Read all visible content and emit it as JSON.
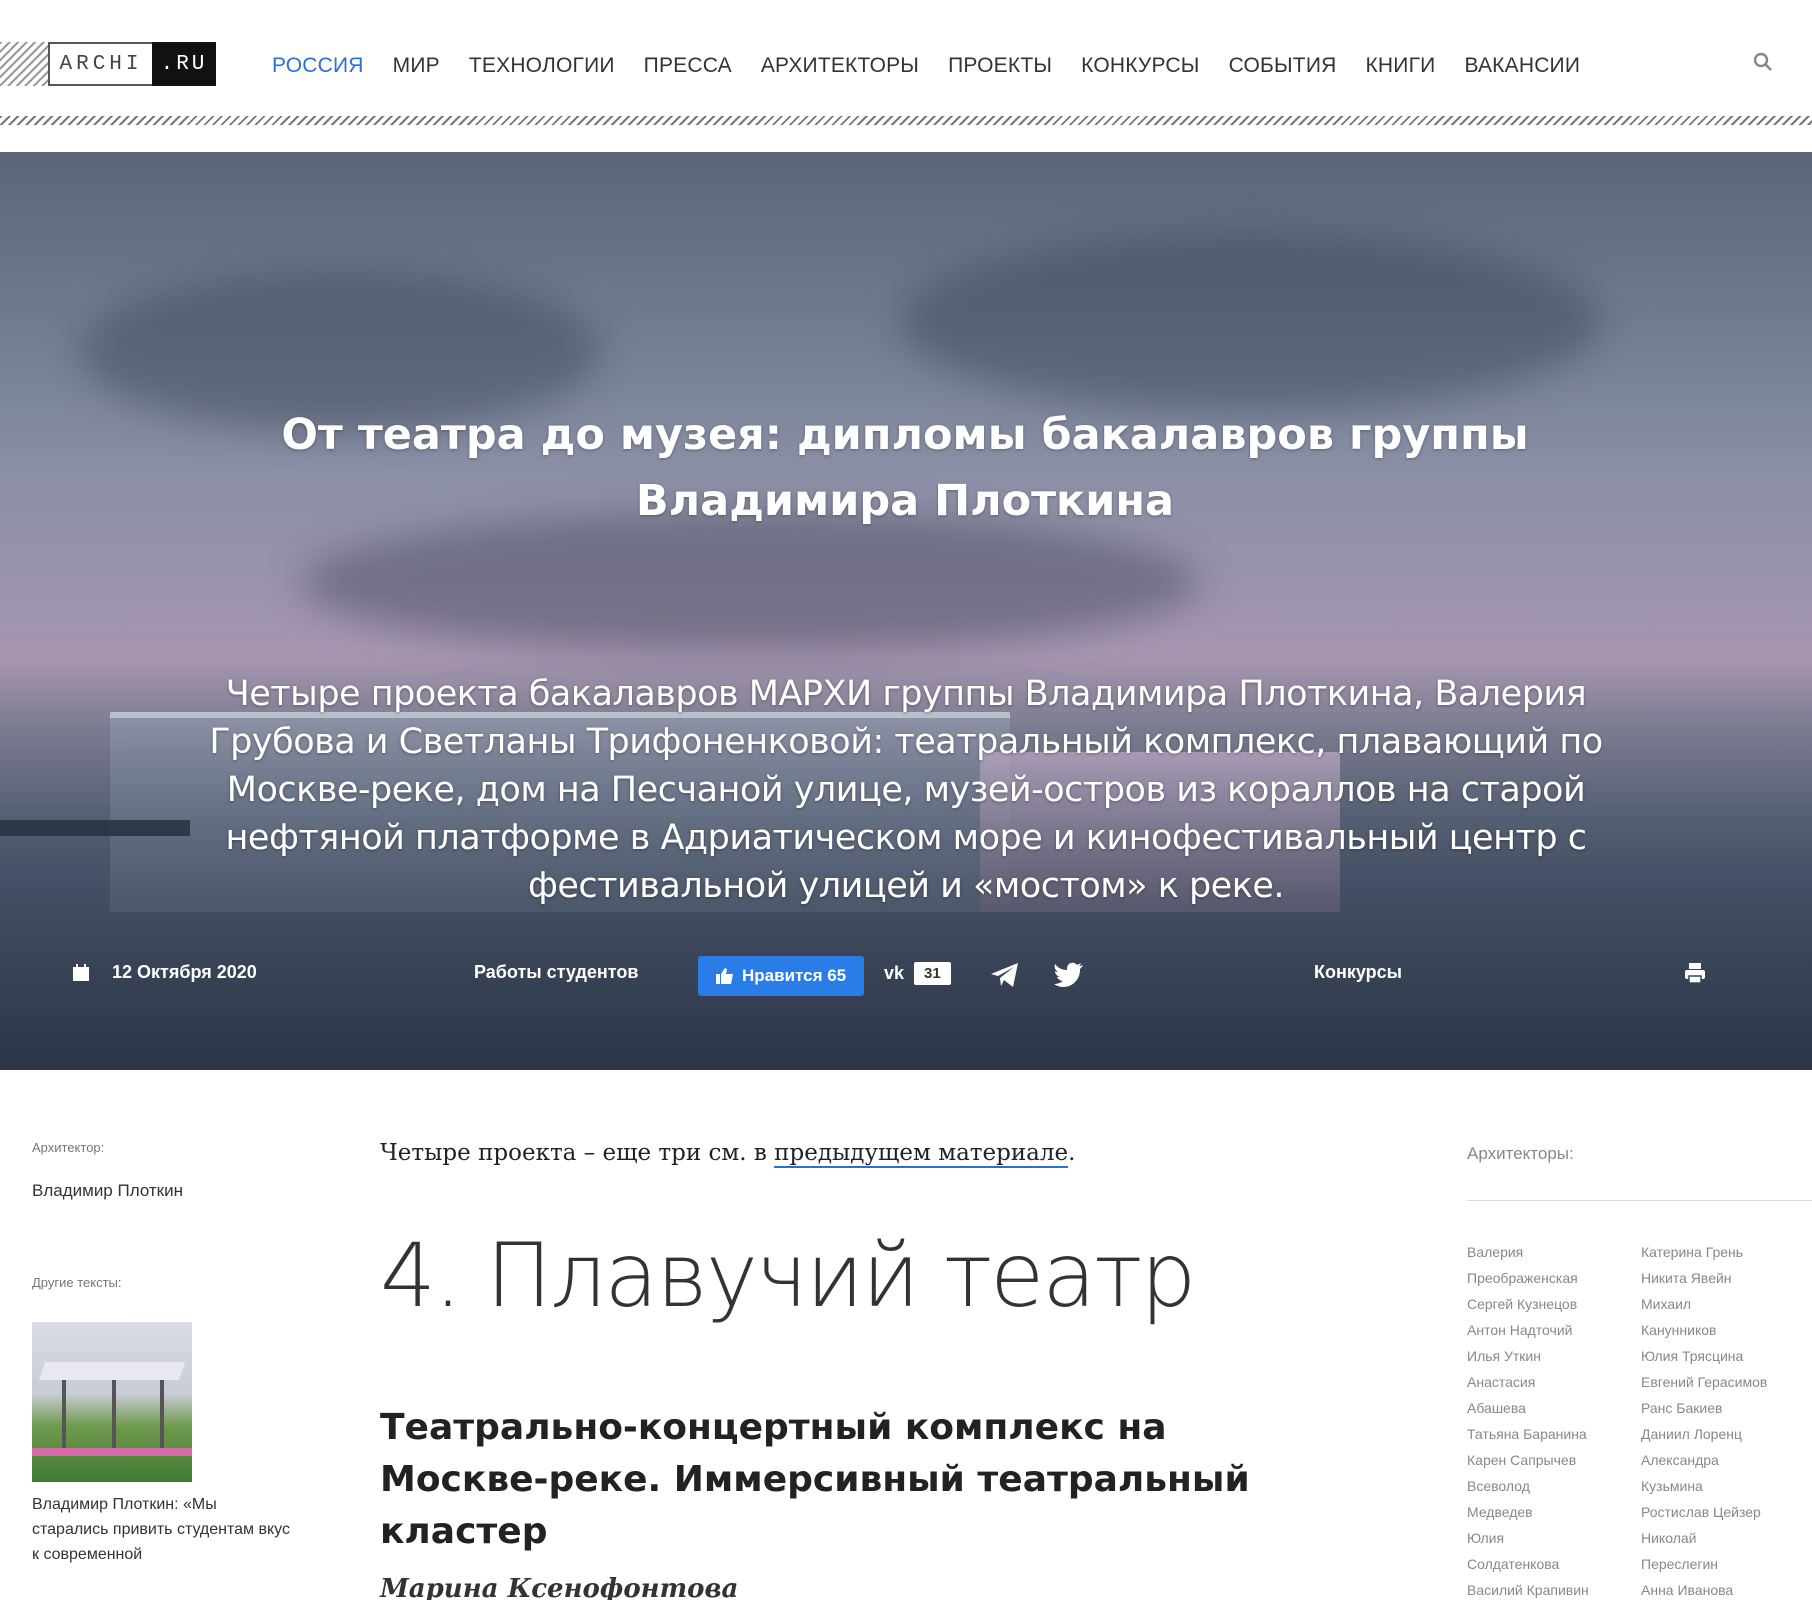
{
  "logo": {
    "archi": "ARCHI",
    "ru": ".RU"
  },
  "nav": [
    "РОССИЯ",
    "МИР",
    "ТЕХНОЛОГИИ",
    "ПРЕССА",
    "АРХИТЕКТОРЫ",
    "ПРОЕКТЫ",
    "КОНКУРСЫ",
    "СОБЫТИЯ",
    "КНИГИ",
    "ВАКАНСИИ"
  ],
  "active_nav": "РОССИЯ",
  "hero": {
    "title": "От театра до музея: дипломы бакалавров группы Владимира Плоткина",
    "lead": "Четыре проекта бакалавров МАРХИ группы Владимира Плоткина, Валерия Грубова и Светланы Трифоненковой: театральный комплекс, плавающий по Москве-реке, дом на Песчаной улице, музей-остров из кораллов на старой нефтяной платформе в Адриатическом море и кинофестивальный центр с фестивальной улицей и «мостом» к реке."
  },
  "meta": {
    "date": "12 Октября 2020",
    "category": "Работы студентов",
    "like_label": "Нравится 65",
    "vk_label": "vk",
    "vk_count": "31",
    "tag": "Конкурсы"
  },
  "left": {
    "architect_label": "Архитектор:",
    "architect_name": "Владимир Плоткин",
    "other_label": "Другие тексты:",
    "other_caption": "Владимир Плоткин: «Мы старались привить студентам вкус к современной"
  },
  "main": {
    "intro_text": "Четыре проекта – еще три см. в ",
    "intro_link": "предыдущем материале",
    "intro_end": ".",
    "section_title": "4. Плавучий театр",
    "heading": "Театрально-концертный комплекс на Москве-реке. Иммерсивный театральный кластер",
    "author": "Марина Ксенофонтова"
  },
  "right": {
    "title": "Архитекторы:",
    "col1": [
      "Валерия",
      "Преображенская",
      "Сергей Кузнецов",
      "Антон Надточий",
      "Илья Уткин",
      "Анастасия",
      "Абашева",
      "Татьяна Баранина",
      "Карен Сапрычев",
      "Всеволод",
      "Медведев",
      "Юлия",
      "Солдатенкова",
      "Василий Крапивин"
    ],
    "col2": [
      "Катерина Грень",
      "Никита Явейн",
      "Михаил",
      "Канунников",
      "Юлия Трясцина",
      "Евгений Герасимов",
      "Ранс Бакиев",
      "Даниил Лоренц",
      "Александра",
      "Кузьмина",
      "Ростислав Цейзер",
      "Николай",
      "Переслегин",
      "Анна Иванова"
    ]
  },
  "colors": {
    "accent": "#2a6fd6",
    "like_button": "#2a7ce6"
  }
}
